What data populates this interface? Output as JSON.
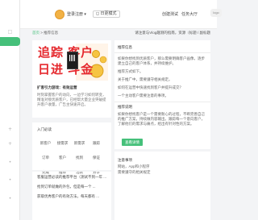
{
  "header": {
    "user_name": "登录注册 ▾",
    "mode_label": "◻ 日更模式",
    "links": [
      "创建测试",
      "任务大厅"
    ],
    "logo_label": "logo"
  },
  "sidebar": {
    "icons": [
      "square-icon",
      "plus-icon",
      "plus-icon",
      "circle-icon",
      "circle-icon",
      "circle-icon"
    ]
  },
  "breadcrumb": {
    "items": [
      "首页",
      "推荐信息"
    ],
    "notice": "请注意与Vlog趣测的指南，资源（标题 / 副标题"
  },
  "left_card": {
    "banner_line1": "追踪 客户",
    "banner_line2": "日进 斗金",
    "title": "扩客引力游戏：有效运营",
    "description": "时刻掌握客户的动向，一边学习如何转变，精准对接优质客户，已经帮大量企业突破提升客户收量，广告主快速开启。",
    "sub_title": "入门必读",
    "grid_items": [
      "新客户",
      "接需求",
      "新需求",
      "跟踪",
      "订单",
      "客户",
      "找到",
      "保证",
      "完成",
      "推荐",
      "活跃",
      "分享"
    ],
    "list_items": [
      "客服运营必读的推荐平台（测试不到一年 ...",
      "抢到订单就做的外包，但是每一个 ...",
      "获取优秀客户的有效方法，每天都有 ..."
    ]
  },
  "right_card_1": {
    "title": "推荐信息",
    "text_1": "如果你想找到优质客户，那么需要明确客户画像，逐步建立自己的客户体系，并持续维护。",
    "text_2": "推荐方式如下。",
    "text_3": "关于推广中，需要遵守相关规定。",
    "text_4": "如何在运营中快速找到客户并提升成交？",
    "text_5": "一个主动客户需要注意的事项。",
    "section_title": "推荐说明",
    "text_6": "如果你想找客户是一个需要耐心的过程，不断完善自己的推广方案，持续做内容输出。跟踪每一个意向客户，了解他们的需求与痛点，给出有针对性的方案。",
    "button_label": "查看详情"
  },
  "right_card_2": {
    "title": "注意事项",
    "text_1": "网站，App和小程序",
    "text_2": "需要遵守的相关规定"
  }
}
